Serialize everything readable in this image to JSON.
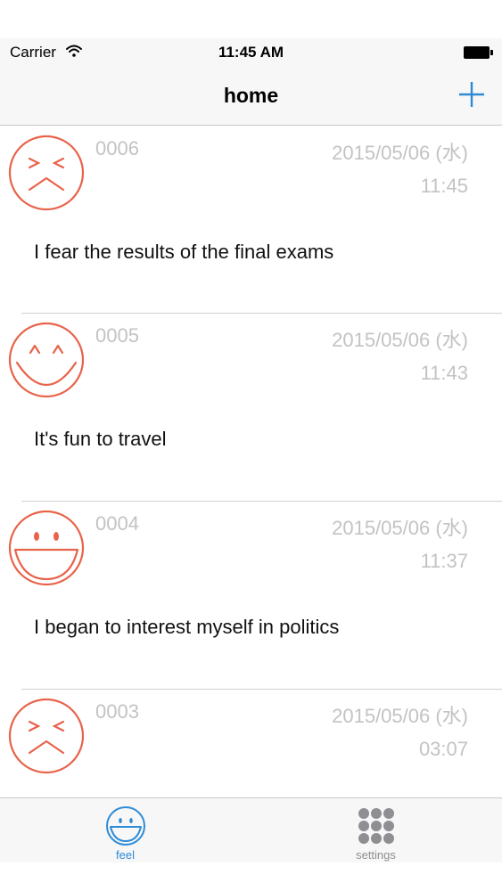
{
  "status_bar": {
    "carrier": "Carrier",
    "time": "11:45 AM"
  },
  "nav": {
    "title": "home",
    "add_icon": "plus-icon"
  },
  "entries": [
    {
      "number": "0006",
      "date": "2015/05/06 (水)",
      "time": "11:45",
      "text": "I fear the results of the final exams",
      "mood": "fear-face-icon"
    },
    {
      "number": "0005",
      "date": "2015/05/06 (水)",
      "time": "11:43",
      "text": "It's fun to travel",
      "mood": "happy-face-icon"
    },
    {
      "number": "0004",
      "date": "2015/05/06 (水)",
      "time": "11:37",
      "text": "I began to interest myself in politics",
      "mood": "laughing-face-icon"
    },
    {
      "number": "0003",
      "date": "2015/05/06 (水)",
      "time": "03:07",
      "text": "",
      "mood": "fear-face-icon"
    }
  ],
  "tabs": [
    {
      "label": "feel",
      "icon": "smile-face-icon"
    },
    {
      "label": "settings",
      "icon": "grid-dots-icon"
    }
  ],
  "colors": {
    "face": "#e8634a",
    "accent": "#2d8bd6",
    "meta_text": "#c3c3c3",
    "inactive_tab": "#8e8e93"
  }
}
